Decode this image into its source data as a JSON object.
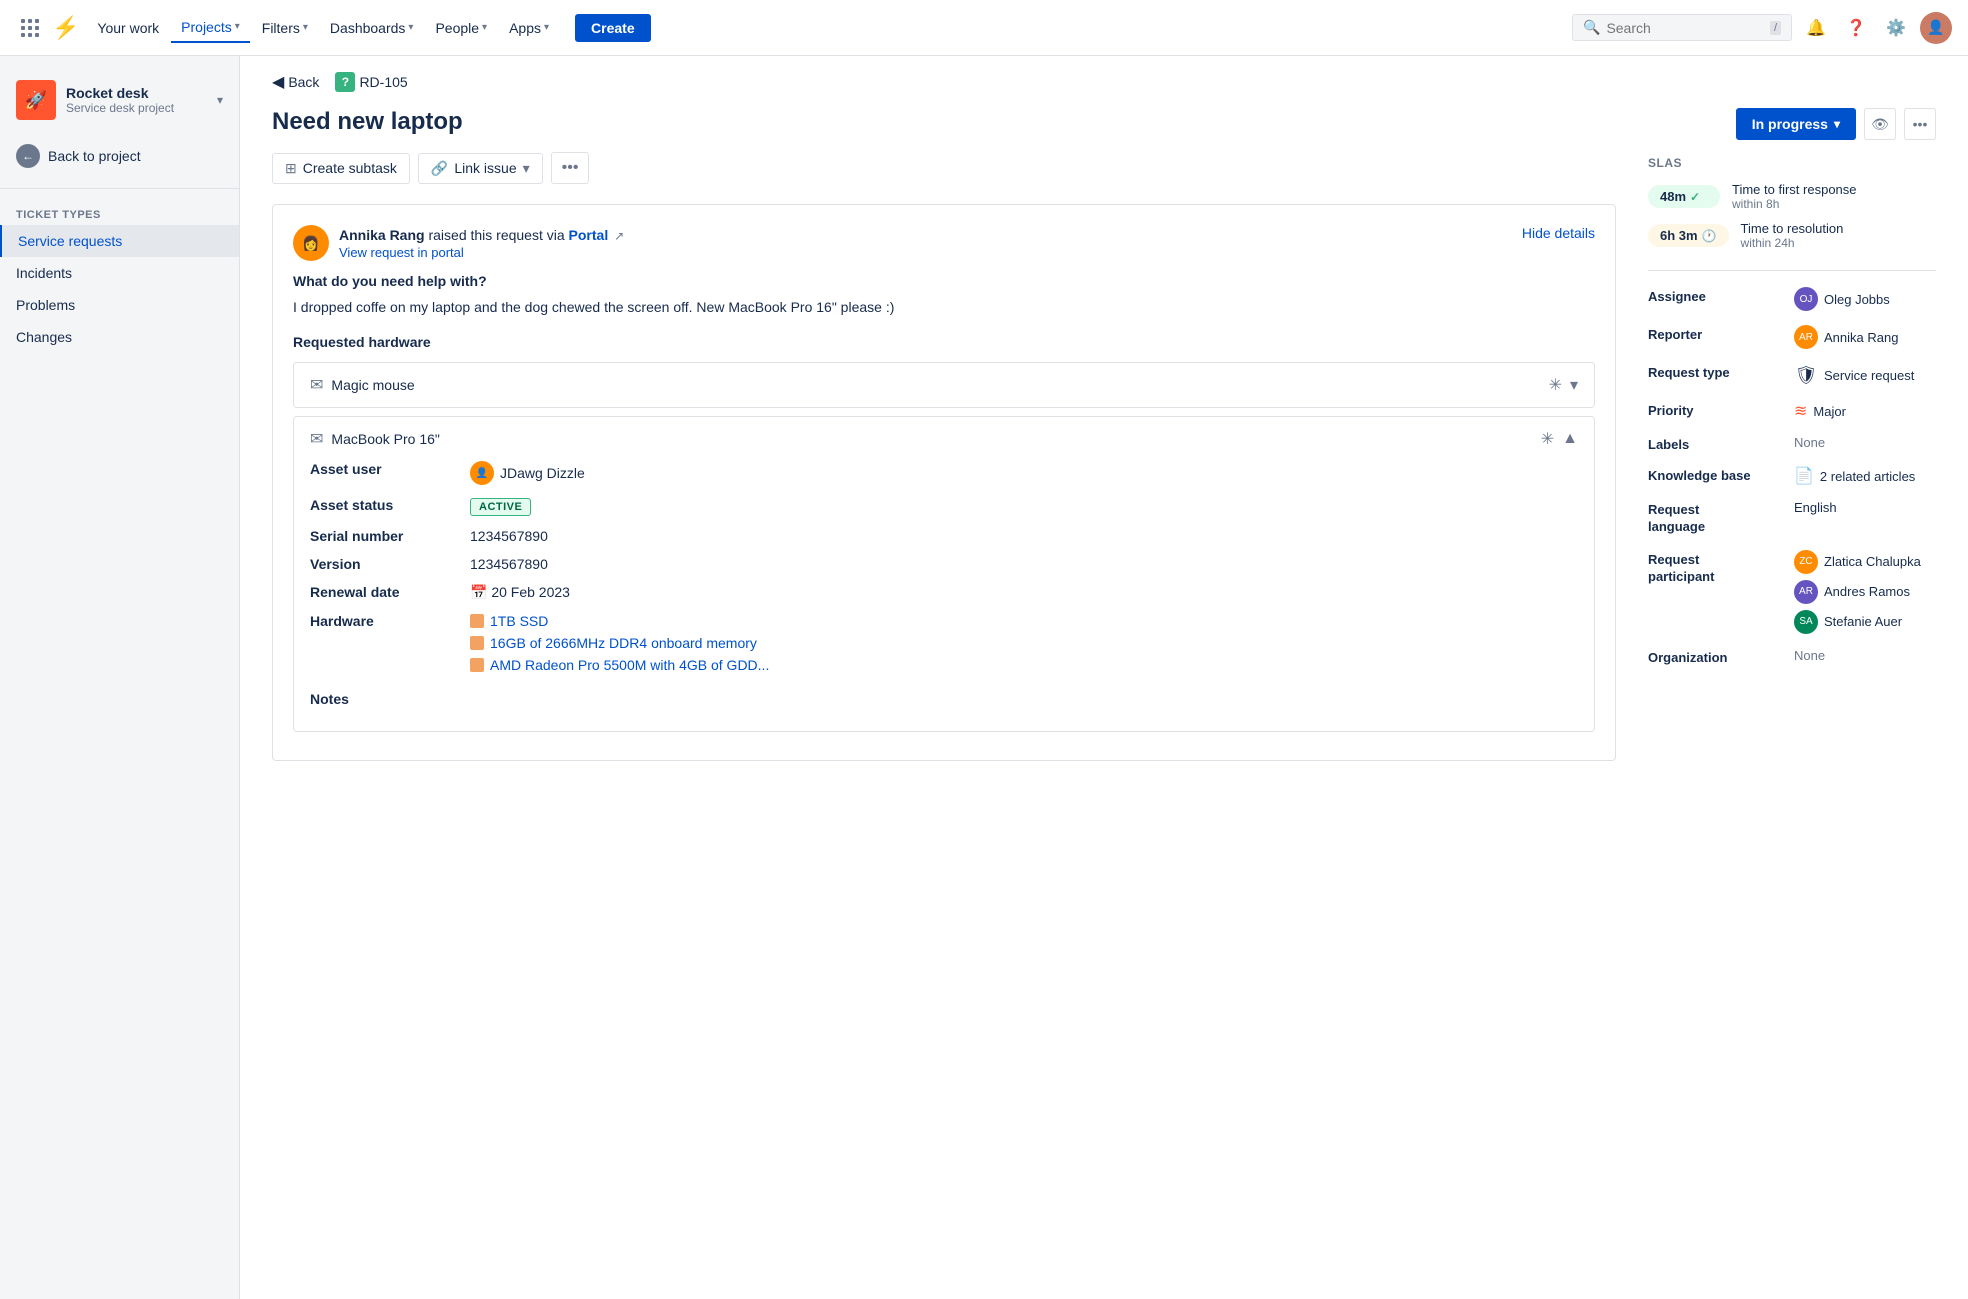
{
  "topnav": {
    "your_work": "Your work",
    "projects": "Projects",
    "filters": "Filters",
    "dashboards": "Dashboards",
    "people": "People",
    "apps": "Apps",
    "create": "Create",
    "search_placeholder": "Search",
    "search_slash": "/"
  },
  "sidebar": {
    "project_name": "Rocket desk",
    "project_type": "Service desk project",
    "back_to_project": "Back to project",
    "section_label": "Ticket types",
    "items": [
      {
        "label": "Service requests",
        "active": true
      },
      {
        "label": "Incidents",
        "active": false
      },
      {
        "label": "Problems",
        "active": false
      },
      {
        "label": "Changes",
        "active": false
      }
    ]
  },
  "breadcrumb": {
    "back": "Back",
    "ticket_id": "RD-105"
  },
  "issue": {
    "title": "Need new laptop",
    "actions": {
      "create_subtask": "Create subtask",
      "link_issue": "Link issue"
    },
    "request": {
      "user_name": "Annika Rang",
      "raised_text": "raised this request via",
      "portal_label": "Portal",
      "view_portal_text": "View request in portal",
      "hide_details": "Hide details",
      "question": "What do you need help with?",
      "description": "I dropped coffe on my laptop and the dog chewed the screen off. New MacBook Pro 16\" please :)",
      "requested_hw_label": "Requested hardware"
    },
    "hardware_items": [
      {
        "name": "Magic mouse",
        "expanded": false
      },
      {
        "name": "MacBook Pro 16\"",
        "expanded": true,
        "asset_user": "JDawg Dizzle",
        "asset_status": "ACTIVE",
        "serial_number": "1234567890",
        "version": "1234567890",
        "renewal_date": "20 Feb 2023",
        "hardware_tags": [
          {
            "label": "1TB SSD"
          },
          {
            "label": "16GB of 2666MHz DDR4 onboard memory"
          },
          {
            "label": "AMD Radeon Pro 5500M with 4GB of GDD..."
          }
        ]
      }
    ],
    "notes_label": "Notes"
  },
  "right_panel": {
    "status": "In progress",
    "slas_title": "SLAs",
    "sla_items": [
      {
        "time": "48m",
        "icon": "check",
        "label": "Time to first response",
        "sublabel": "within 8h",
        "style": "success"
      },
      {
        "time": "6h 3m",
        "icon": "clock",
        "label": "Time to resolution",
        "sublabel": "within 24h",
        "style": "warning"
      }
    ],
    "fields": {
      "assignee_label": "Assignee",
      "assignee_value": "Oleg Jobbs",
      "reporter_label": "Reporter",
      "reporter_value": "Annika Rang",
      "request_type_label": "Request type",
      "request_type_value": "Service request",
      "priority_label": "Priority",
      "priority_value": "Major",
      "labels_label": "Labels",
      "labels_value": "None",
      "knowledge_base_label": "Knowledge base",
      "knowledge_base_value": "2 related articles",
      "request_language_label": "Request language",
      "request_language_value": "English",
      "request_participant_label": "Request participant",
      "participants": [
        {
          "name": "Zlatica Chalupka",
          "color": "#ff8b00"
        },
        {
          "name": "Andres Ramos",
          "color": "#6554c0"
        },
        {
          "name": "Stefanie Auer",
          "color": "#00875a"
        }
      ],
      "organization_label": "Organization",
      "organization_value": "None"
    }
  }
}
